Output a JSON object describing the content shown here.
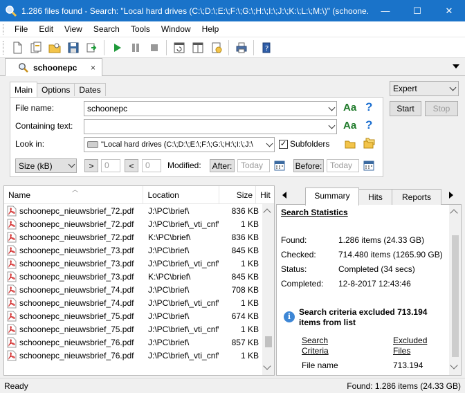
{
  "window": {
    "title": "1.286 files found - Search: \"Local hard drives (C:\\;D:\\;E:\\;F:\\;G:\\;H:\\;I:\\;J:\\;K:\\;L:\\;M:\\)\" (schoone...",
    "minimize_label": "—",
    "maximize_label": "☐",
    "close_label": "✕"
  },
  "menu": [
    "File",
    "Edit",
    "View",
    "Search",
    "Tools",
    "Window",
    "Help"
  ],
  "doc_tab": {
    "label": "schoonepc",
    "close_label": "×"
  },
  "search_form": {
    "tabs": [
      "Main",
      "Options",
      "Dates"
    ],
    "file_name_label": "File name:",
    "file_name_value": "schoonepc",
    "containing_text_label": "Containing text:",
    "containing_text_value": "",
    "look_in_label": "Look in:",
    "look_in_value": "\"Local hard drives (C:\\;D:\\;E:\\;F:\\;G:\\;H:\\;I:\\;J:\\",
    "subfolders_label": "Subfolders",
    "subfolders_checked": true,
    "match_case_label": "Aa",
    "help_label": "?",
    "size_unit": "Size (kB)",
    "gt_label": ">",
    "gt_value": "0",
    "lt_label": "<",
    "lt_value": "0",
    "modified_label": "Modified:",
    "after_label": "After:",
    "after_value": "Today",
    "before_label": "Before:",
    "before_value": "Today"
  },
  "side_controls": {
    "mode": "Expert",
    "start_label": "Start",
    "stop_label": "Stop"
  },
  "results": {
    "columns": [
      "Name",
      "Location",
      "Size",
      "Hit"
    ],
    "rows": [
      {
        "name": "schoonepc_nieuwsbrief_72.pdf",
        "location": "J:\\PC\\brief\\",
        "size": "836 KB"
      },
      {
        "name": "schoonepc_nieuwsbrief_72.pdf",
        "location": "J:\\PC\\brief\\_vti_cnf\\",
        "size": "1 KB"
      },
      {
        "name": "schoonepc_nieuwsbrief_72.pdf",
        "location": "K:\\PC\\brief\\",
        "size": "836 KB"
      },
      {
        "name": "schoonepc_nieuwsbrief_73.pdf",
        "location": "J:\\PC\\brief\\",
        "size": "845 KB"
      },
      {
        "name": "schoonepc_nieuwsbrief_73.pdf",
        "location": "J:\\PC\\brief\\_vti_cnf\\",
        "size": "1 KB"
      },
      {
        "name": "schoonepc_nieuwsbrief_73.pdf",
        "location": "K:\\PC\\brief\\",
        "size": "845 KB"
      },
      {
        "name": "schoonepc_nieuwsbrief_74.pdf",
        "location": "J:\\PC\\brief\\",
        "size": "708 KB"
      },
      {
        "name": "schoonepc_nieuwsbrief_74.pdf",
        "location": "J:\\PC\\brief\\_vti_cnf\\",
        "size": "1 KB"
      },
      {
        "name": "schoonepc_nieuwsbrief_75.pdf",
        "location": "J:\\PC\\brief\\",
        "size": "674 KB"
      },
      {
        "name": "schoonepc_nieuwsbrief_75.pdf",
        "location": "J:\\PC\\brief\\_vti_cnf\\",
        "size": "1 KB"
      },
      {
        "name": "schoonepc_nieuwsbrief_76.pdf",
        "location": "J:\\PC\\brief\\",
        "size": "857 KB"
      },
      {
        "name": "schoonepc_nieuwsbrief_76.pdf",
        "location": "J:\\PC\\brief\\_vti_cnf\\",
        "size": "1 KB"
      }
    ]
  },
  "stats": {
    "tabs": [
      "Summary",
      "Hits",
      "Reports"
    ],
    "title": "Search Statistics",
    "found_label": "Found:",
    "found_value": "1.286 items (24.33 GB)",
    "checked_label": "Checked:",
    "checked_value": "714.480 items (1265.90 GB)",
    "status_label": "Status:",
    "status_value": "Completed (34 secs)",
    "completed_label": "Completed:",
    "completed_value": "12-8-2017 12:43:46",
    "excluded_line1": "Search criteria excluded 713.194",
    "excluded_line2": "items from list",
    "col_criteria_1": "Search",
    "col_criteria_2": "Criteria",
    "col_excluded_1": "Excluded",
    "col_excluded_2": "Files",
    "crit_row_name": "File name",
    "crit_row_value": "713.194"
  },
  "statusbar": {
    "left": "Ready",
    "right": "Found: 1.286 items (24.33 GB)"
  },
  "colors": {
    "titlebar": "#1a73c9",
    "accent_green": "#1f7a2a",
    "help_blue": "#1c6fd0",
    "pdf_red": "#d32f2f"
  }
}
